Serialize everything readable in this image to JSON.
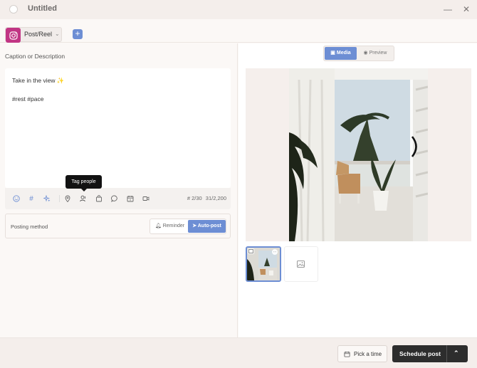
{
  "window": {
    "title": "Untitled",
    "minimize_glyph": "—",
    "close_glyph": "✕"
  },
  "channel": {
    "label": "Post/Reel",
    "icon": "instagram-icon",
    "brand_color": "#c13584",
    "add_glyph": "+"
  },
  "composer": {
    "section_label": "Caption or Description",
    "caption_line1": "Take in the view",
    "caption_emoji": "✨",
    "caption_line2": "#rest #pace",
    "hashtag_count": "# 2/30",
    "char_count": "31/2,200",
    "tooltip": "Tag people",
    "toolbar_icons": [
      "emoji-icon",
      "hashtag-icon",
      "ai-assistant-icon",
      "location-icon",
      "tag-people-icon",
      "shopping-bag-icon",
      "comment-icon",
      "calendar-icon",
      "video-icon"
    ]
  },
  "posting_method": {
    "label": "Posting method",
    "reminder_label": "Reminder",
    "autopost_label": "Auto-post",
    "selected": "Auto-post"
  },
  "media_panel": {
    "media_tab": "Media",
    "preview_tab": "Preview",
    "active_tab": "Media"
  },
  "footer": {
    "pick_time_label": "Pick a time",
    "schedule_label": "Schedule post"
  },
  "colors": {
    "accent": "#6d8ed4",
    "primary_dark": "#2d2d2d"
  }
}
